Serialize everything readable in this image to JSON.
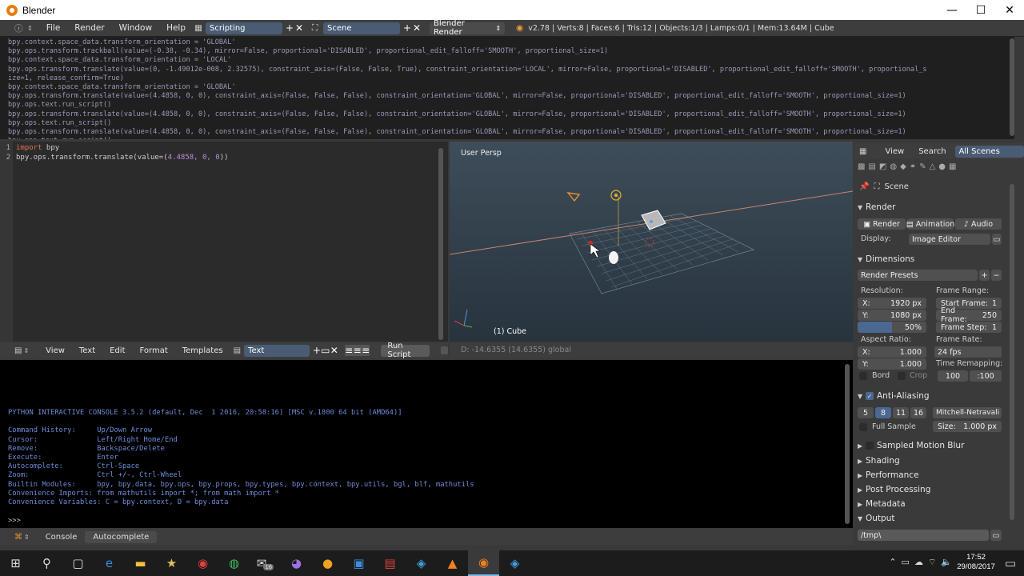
{
  "window": {
    "title": "Blender",
    "minimize": "—",
    "maximize": "☐",
    "close": "✕"
  },
  "info_header": {
    "menus": [
      "File",
      "Render",
      "Window",
      "Help"
    ],
    "screen_layout": "Scripting",
    "scene": "Scene",
    "render_engine": "Blender Render",
    "stats": "v2.78 | Verts:8 | Faces:6 | Tris:12 | Objects:1/3 | Lamps:0/1 | Mem:13.64M | Cube"
  },
  "log_lines": [
    "bpy.context.space_data.transform_orientation = 'GLOBAL'",
    "bpy.ops.transform.trackball(value=(-0.38, -0.34), mirror=False, proportional='DISABLED', proportional_edit_falloff='SMOOTH', proportional_size=1)",
    "bpy.context.space_data.transform_orientation = 'LOCAL'",
    "bpy.ops.transform.translate(value=(0, -1.49012e-008, 2.32575), constraint_axis=(False, False, True), constraint_orientation='LOCAL', mirror=False, proportional='DISABLED', proportional_edit_falloff='SMOOTH', proportional_s",
    "ize=1, release_confirm=True)",
    "bpy.context.space_data.transform_orientation = 'GLOBAL'",
    "bpy.ops.transform.translate(value=(4.4858, 0, 0), constraint_axis=(False, False, False), constraint_orientation='GLOBAL', mirror=False, proportional='DISABLED', proportional_edit_falloff='SMOOTH', proportional_size=1)",
    "bpy.ops.text.run_script()",
    "bpy.ops.transform.translate(value=(4.4858, 0, 0), constraint_axis=(False, False, False), constraint_orientation='GLOBAL', mirror=False, proportional='DISABLED', proportional_edit_falloff='SMOOTH', proportional_size=1)",
    "bpy.ops.text.run_script()",
    "bpy.ops.transform.translate(value=(4.4858, 0, 0), constraint_axis=(False, False, False), constraint_orientation='GLOBAL', mirror=False, proportional='DISABLED', proportional_edit_falloff='SMOOTH', proportional_size=1)",
    "bpy.ops.text.run_script()"
  ],
  "text_editor": {
    "line_numbers": [
      "1",
      "2"
    ],
    "line1_kw": "import",
    "line1_rest": " bpy",
    "line2_a": "bpy.ops.transform.translate(value=(",
    "line2_num": "4.4858, 0, 0",
    "line2_b": "))",
    "menus": [
      "View",
      "Text",
      "Edit",
      "Format",
      "Templates"
    ],
    "text_name": "Text",
    "run_script": "Run Script"
  },
  "viewport": {
    "view_label": "User Persp",
    "object_label": "(1) Cube",
    "status": "D: -14.6355 (14.6355) global"
  },
  "console": {
    "lines": [
      "PYTHON INTERACTIVE CONSOLE 3.5.2 (default, Dec  1 2016, 20:58:16) [MSC v.1800 64 bit (AMD64)]",
      "",
      "Command History:     Up/Down Arrow",
      "Cursor:              Left/Right Home/End",
      "Remove:              Backspace/Delete",
      "Execute:             Enter",
      "Autocomplete:        Ctrl-Space",
      "Zoom:                Ctrl +/-, Ctrl-Wheel",
      "Builtin Modules:     bpy, bpy.data, bpy.ops, bpy.props, bpy.types, bpy.context, bpy.utils, bgl, blf, mathutils",
      "Convenience Imports: from mathutils import *; from math import *",
      "Convenience Variables: C = bpy.context, D = bpy.data"
    ],
    "prompt": ">>> ",
    "tabs": [
      "Console",
      "Autocomplete"
    ]
  },
  "properties": {
    "header": [
      "View",
      "Search",
      "All Scenes"
    ],
    "scene_label": "Scene",
    "render": {
      "title": "Render",
      "buttons": [
        "Render",
        "Animation",
        "Audio"
      ],
      "display_label": "Display:",
      "display_value": "Image Editor"
    },
    "dimensions": {
      "title": "Dimensions",
      "presets": "Render Presets",
      "resolution_label": "Resolution:",
      "res_x": "X:",
      "res_x_val": "1920 px",
      "res_y": "Y:",
      "res_y_val": "1080 px",
      "res_pct": "50%",
      "frame_range_label": "Frame Range:",
      "start_frame": "Start Frame:",
      "start_frame_val": "1",
      "end_frame": "End Frame:",
      "end_frame_val": "250",
      "frame_step": "Frame Step:",
      "frame_step_val": "1",
      "aspect_label": "Aspect Ratio:",
      "asp_x": "X:",
      "asp_x_val": "1.000",
      "asp_y": "Y:",
      "asp_y_val": "1.000",
      "frame_rate_label": "Frame Rate:",
      "frame_rate_val": "24 fps",
      "time_remap_label": "Time Remapping:",
      "time_remap_old": "100",
      "time_remap_new": ":100",
      "bord": "Bord",
      "crop": "Crop"
    },
    "anti_aliasing": {
      "title": "Anti-Aliasing",
      "samples": [
        "5",
        "8",
        "11",
        "16"
      ],
      "filter": "Mitchell-Netravali",
      "full_sample": "Full Sample",
      "size_label": "Size:",
      "size_val": "1.000 px"
    },
    "collapsed": [
      "Sampled Motion Blur",
      "Shading",
      "Performance",
      "Post Processing",
      "Metadata"
    ],
    "output": {
      "title": "Output",
      "path": "/tmp\\"
    }
  },
  "taskbar": {
    "icons": [
      "windows-icon",
      "search-icon",
      "task-view-icon",
      "edge-icon",
      "explorer-icon",
      "star-icon",
      "chrome-icon",
      "app-icon",
      "mail-icon",
      "onenote-icon",
      "orange-icon",
      "store-icon",
      "clipboard-icon",
      "diamond-icon",
      "vlc-icon",
      "blender-icon",
      "diamond-icon-2"
    ],
    "mail_badge": "16",
    "time": "17:52",
    "date": "29/08/2017"
  },
  "colors": {
    "accent": "#4a6892",
    "header": "#3d3d3d",
    "console_text": "#6f8bd8"
  }
}
